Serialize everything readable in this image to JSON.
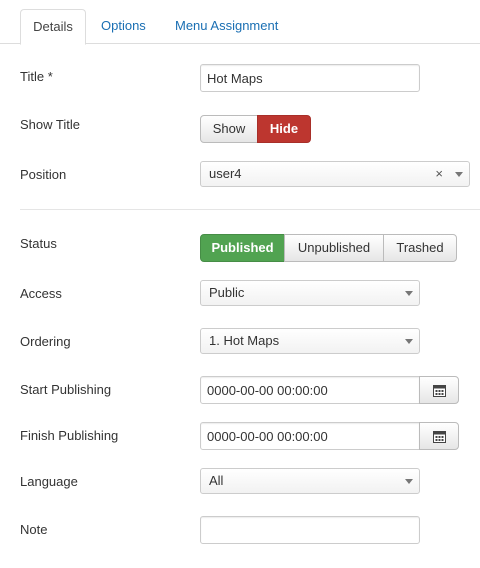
{
  "tabs": [
    {
      "label": "Details",
      "active": true
    },
    {
      "label": "Options",
      "active": false
    },
    {
      "label": "Menu Assignment",
      "active": false
    }
  ],
  "fields": {
    "title": {
      "label": "Title *",
      "value": "Hot Maps"
    },
    "show_title": {
      "label": "Show Title",
      "options": [
        "Show",
        "Hide"
      ],
      "selected": "Hide"
    },
    "position": {
      "label": "Position",
      "value": "user4",
      "clear_glyph": "×"
    },
    "status": {
      "label": "Status",
      "options": [
        "Published",
        "Unpublished",
        "Trashed"
      ],
      "selected": "Published"
    },
    "access": {
      "label": "Access",
      "value": "Public"
    },
    "ordering": {
      "label": "Ordering",
      "value": "1. Hot Maps"
    },
    "start_publishing": {
      "label": "Start Publishing",
      "value": "0000-00-00 00:00:00"
    },
    "finish_publishing": {
      "label": "Finish Publishing",
      "value": "0000-00-00 00:00:00"
    },
    "language": {
      "label": "Language",
      "value": "All"
    },
    "note": {
      "label": "Note",
      "value": ""
    }
  },
  "colors": {
    "link": "#1a6fb3",
    "hide_active": "#bd362f",
    "published_active": "#51a351"
  },
  "icons": {
    "calendar": "calendar-icon",
    "dropdown": "chevron-down-icon"
  }
}
